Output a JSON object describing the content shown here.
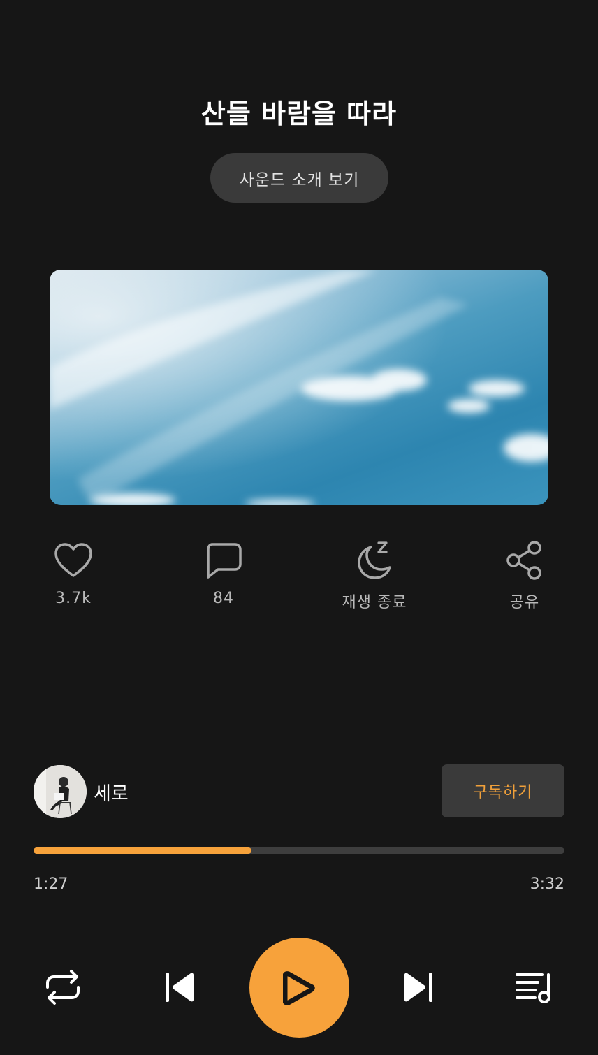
{
  "track": {
    "title": "산들 바람을 따라",
    "intro_button": "사운드 소개 보기"
  },
  "actions": [
    {
      "icon": "heart-icon",
      "label": "3.7k"
    },
    {
      "icon": "comment-icon",
      "label": "84"
    },
    {
      "icon": "sleep-moon-icon",
      "label": "재생 종료"
    },
    {
      "icon": "share-icon",
      "label": "공유"
    }
  ],
  "artist": {
    "name": "세로",
    "subscribe_label": "구독하기"
  },
  "playback": {
    "current_time": "1:27",
    "total_time": "3:32",
    "progress_fraction": 0.41
  },
  "colors": {
    "accent": "#f7a23b",
    "background": "#161616",
    "button_bg": "#3a3a3a"
  }
}
